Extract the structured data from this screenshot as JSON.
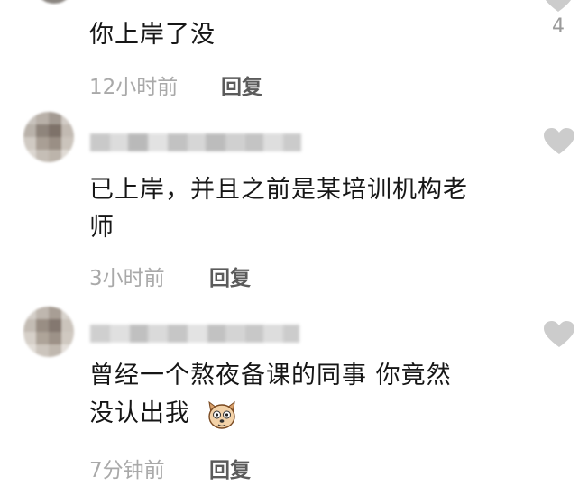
{
  "comments": [
    {
      "text": "你上岸了没",
      "time": "12小时前",
      "reply_label": "回复",
      "like_count": "4"
    },
    {
      "text_line1": "已上岸，并且之前是某培训机构老",
      "text_line2": "师",
      "time": "3小时前",
      "reply_label": "回复"
    },
    {
      "text_line1": "曾经一个熬夜备课的同事 你竟然",
      "text_line2": "没认出我",
      "emoji": "dog-face-emoji",
      "time": "7分钟前",
      "reply_label": "回复"
    }
  ],
  "colors": {
    "heart": "#cccccc",
    "meta": "#a9a9a9",
    "reply": "#5b5b5b",
    "text": "#161616"
  }
}
